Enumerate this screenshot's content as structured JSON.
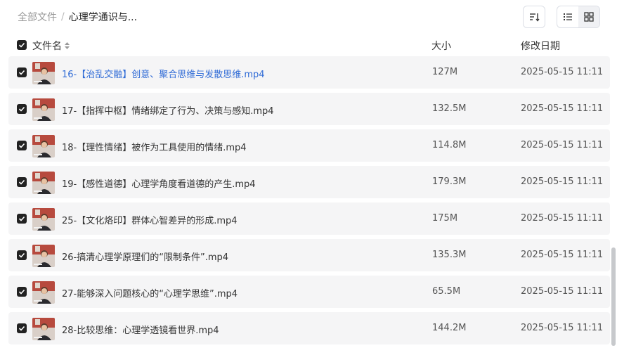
{
  "breadcrumb": {
    "root": "全部文件",
    "separator": "/",
    "current": "心理学通识与..."
  },
  "header": {
    "name": "文件名",
    "size": "大小",
    "modified": "修改日期"
  },
  "colors": {
    "link": "#2f6bd6",
    "row_bg": "#f5f5f6",
    "checkbox": "#222222"
  },
  "files": [
    {
      "name": "16-【治乱交融】创意、聚合思维与发散思维.mp4",
      "size": "127M",
      "date": "2025-05-15 11:11",
      "link": true
    },
    {
      "name": "17-【指挥中枢】情绪绑定了行为、决策与感知.mp4",
      "size": "132.5M",
      "date": "2025-05-15 11:11",
      "link": false
    },
    {
      "name": "18-【理性情绪】被作为工具使用的情绪.mp4",
      "size": "114.8M",
      "date": "2025-05-15 11:11",
      "link": false
    },
    {
      "name": "19-【感性道德】心理学角度看道德的产生.mp4",
      "size": "179.3M",
      "date": "2025-05-15 11:11",
      "link": false
    },
    {
      "name": "25-【文化烙印】群体心智差异的形成.mp4",
      "size": "175M",
      "date": "2025-05-15 11:11",
      "link": false
    },
    {
      "name": "26-搞清心理学原理们的“限制条件”.mp4",
      "size": "135.3M",
      "date": "2025-05-15 11:11",
      "link": false
    },
    {
      "name": "27-能够深入问题核心的“心理学思维”.mp4",
      "size": "65.5M",
      "date": "2025-05-15 11:11",
      "link": false
    },
    {
      "name": "28-比较思维：心理学透镜看世界.mp4",
      "size": "144.2M",
      "date": "2025-05-15 11:11",
      "link": false
    }
  ]
}
